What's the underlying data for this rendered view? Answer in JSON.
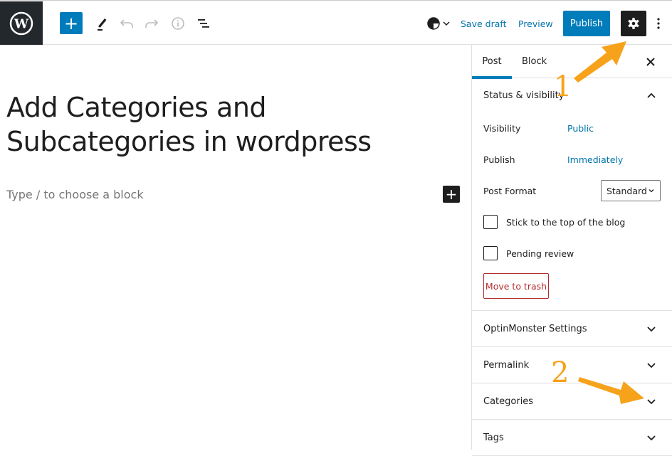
{
  "toolbar": {
    "logo": "wordpress-logo",
    "add_block_label": "+",
    "icons": [
      "edit-pencil-icon",
      "undo-icon",
      "redo-icon",
      "info-icon",
      "list-view-icon"
    ],
    "save_draft": "Save draft",
    "preview": "Preview",
    "publish": "Publish",
    "settings_icon": "gear-icon",
    "more_icon": "vertical-ellipsis-icon"
  },
  "editor": {
    "title": "Add Categories and Subcategories in wordpress",
    "placeholder": "Type / to choose a block",
    "add_block_label": "+"
  },
  "sidebar": {
    "tabs": [
      {
        "label": "Post",
        "active": true
      },
      {
        "label": "Block",
        "active": false
      }
    ],
    "close_label": "✕",
    "status_panel": {
      "title": "Status & visibility",
      "expanded": true,
      "rows": [
        {
          "label": "Visibility",
          "value": "Public"
        },
        {
          "label": "Publish",
          "value": "Immediately"
        },
        {
          "label": "Post Format",
          "value": "Standard"
        }
      ],
      "checkboxes": [
        {
          "label": "Stick to the top of the blog",
          "checked": false
        },
        {
          "label": "Pending review",
          "checked": false
        }
      ],
      "trash_label": "Move to trash"
    },
    "panels": [
      {
        "title": "OptinMonster Settings",
        "expanded": false
      },
      {
        "title": "Permalink",
        "expanded": false
      },
      {
        "title": "Categories",
        "expanded": false
      },
      {
        "title": "Tags",
        "expanded": false
      }
    ]
  },
  "annotations": {
    "step1": "1",
    "step2": "2",
    "color": "#f7a21b"
  },
  "colors": {
    "accent": "#007cba",
    "link": "#0073aa",
    "danger": "#b32d2e",
    "dark": "#1e1e1e",
    "logo_bg": "#23282d"
  }
}
